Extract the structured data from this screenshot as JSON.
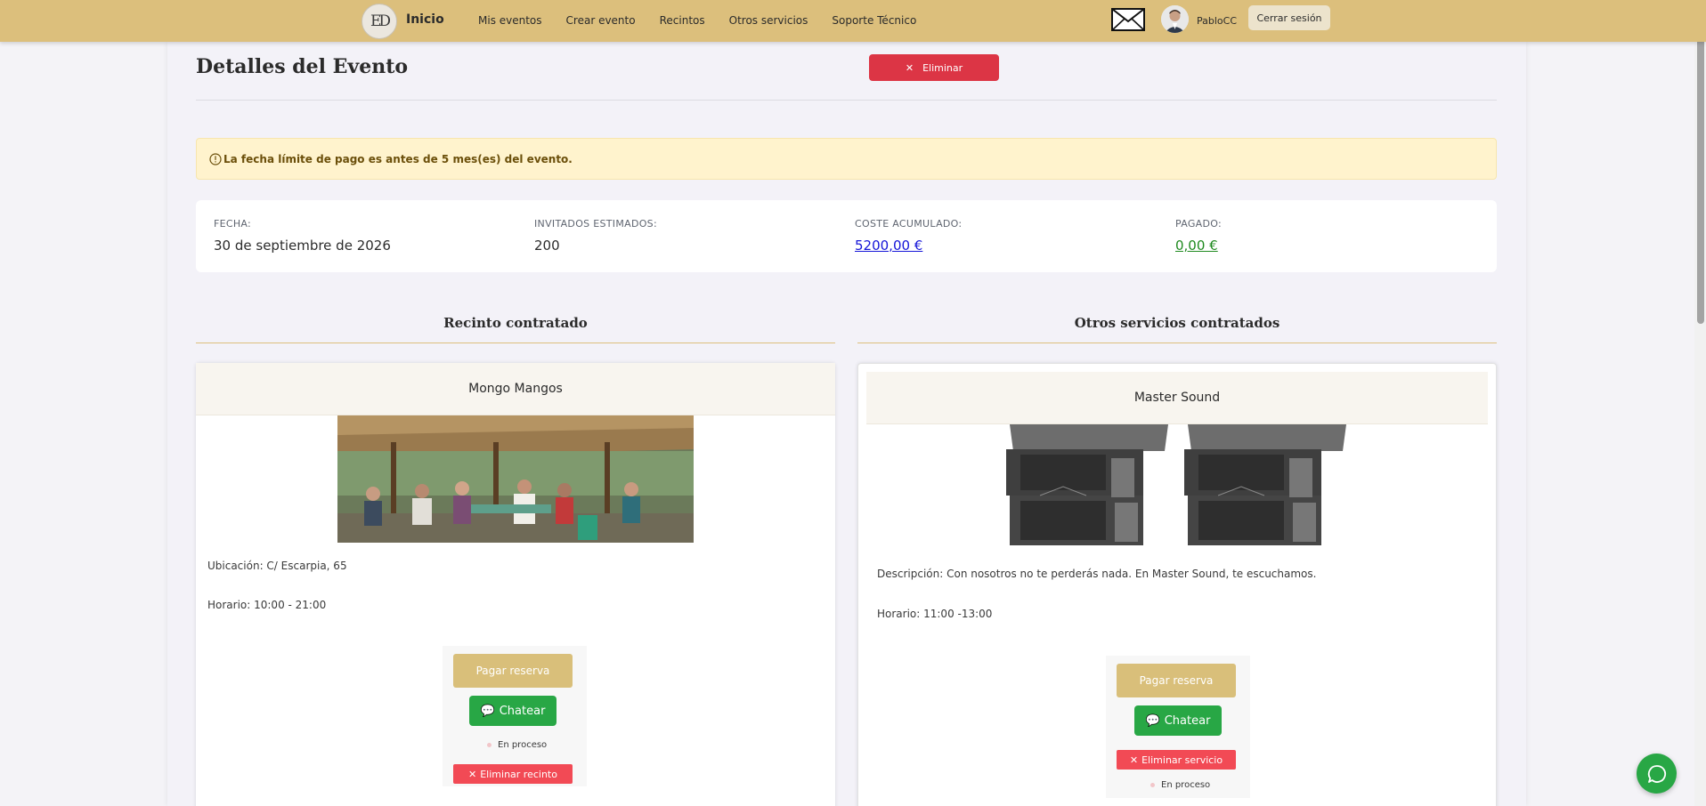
{
  "navbar": {
    "logo_text": "ED",
    "home_label": "Inicio",
    "links": [
      "Mis eventos",
      "Crear evento",
      "Recintos",
      "Otros servicios",
      "Soporte Técnico"
    ],
    "username": "PabloCC",
    "logout_label": "Cerrar sesión"
  },
  "page": {
    "title": "Detalles del Evento",
    "delete_label": "Eliminar",
    "alert_text": "La fecha límite de pago es antes de 5 mes(es) del evento."
  },
  "stats": [
    {
      "label": "FECHA:",
      "value": "30 de septiembre de 2026"
    },
    {
      "label": "INVITADOS ESTIMADOS:",
      "value": "200"
    },
    {
      "label": "COSTE ACUMULADO:",
      "value": "5200,00 €"
    },
    {
      "label": "PAGADO:",
      "value": "0,00 €"
    }
  ],
  "venue_section": {
    "title": "Recinto contratado",
    "card": {
      "name": "Mongo Mangos",
      "location": "Ubicación: C/ Escarpia, 65",
      "schedule": "Horario: 10:00 - 21:00",
      "pay_label": "Pagar reserva",
      "chat_label": "Chatear",
      "status": "En proceso",
      "remove_label": "Eliminar recinto"
    }
  },
  "services_section": {
    "title": "Otros servicios contratados",
    "card": {
      "name": "Master Sound",
      "description": "Descripción: Con nosotros no te perderás nada. En Master Sound, te escuchamos.",
      "schedule": "Horario: 11:00 -13:00",
      "pay_label": "Pagar reserva",
      "chat_label": "Chatear",
      "remove_label": "Eliminar servicio",
      "status": "En proceso"
    }
  },
  "colors": {
    "navbar": "#dcbf7c",
    "danger": "#dc3545",
    "success": "#28a745",
    "pay_button": "#d9bf7a",
    "alert_bg": "#fff3cd"
  }
}
